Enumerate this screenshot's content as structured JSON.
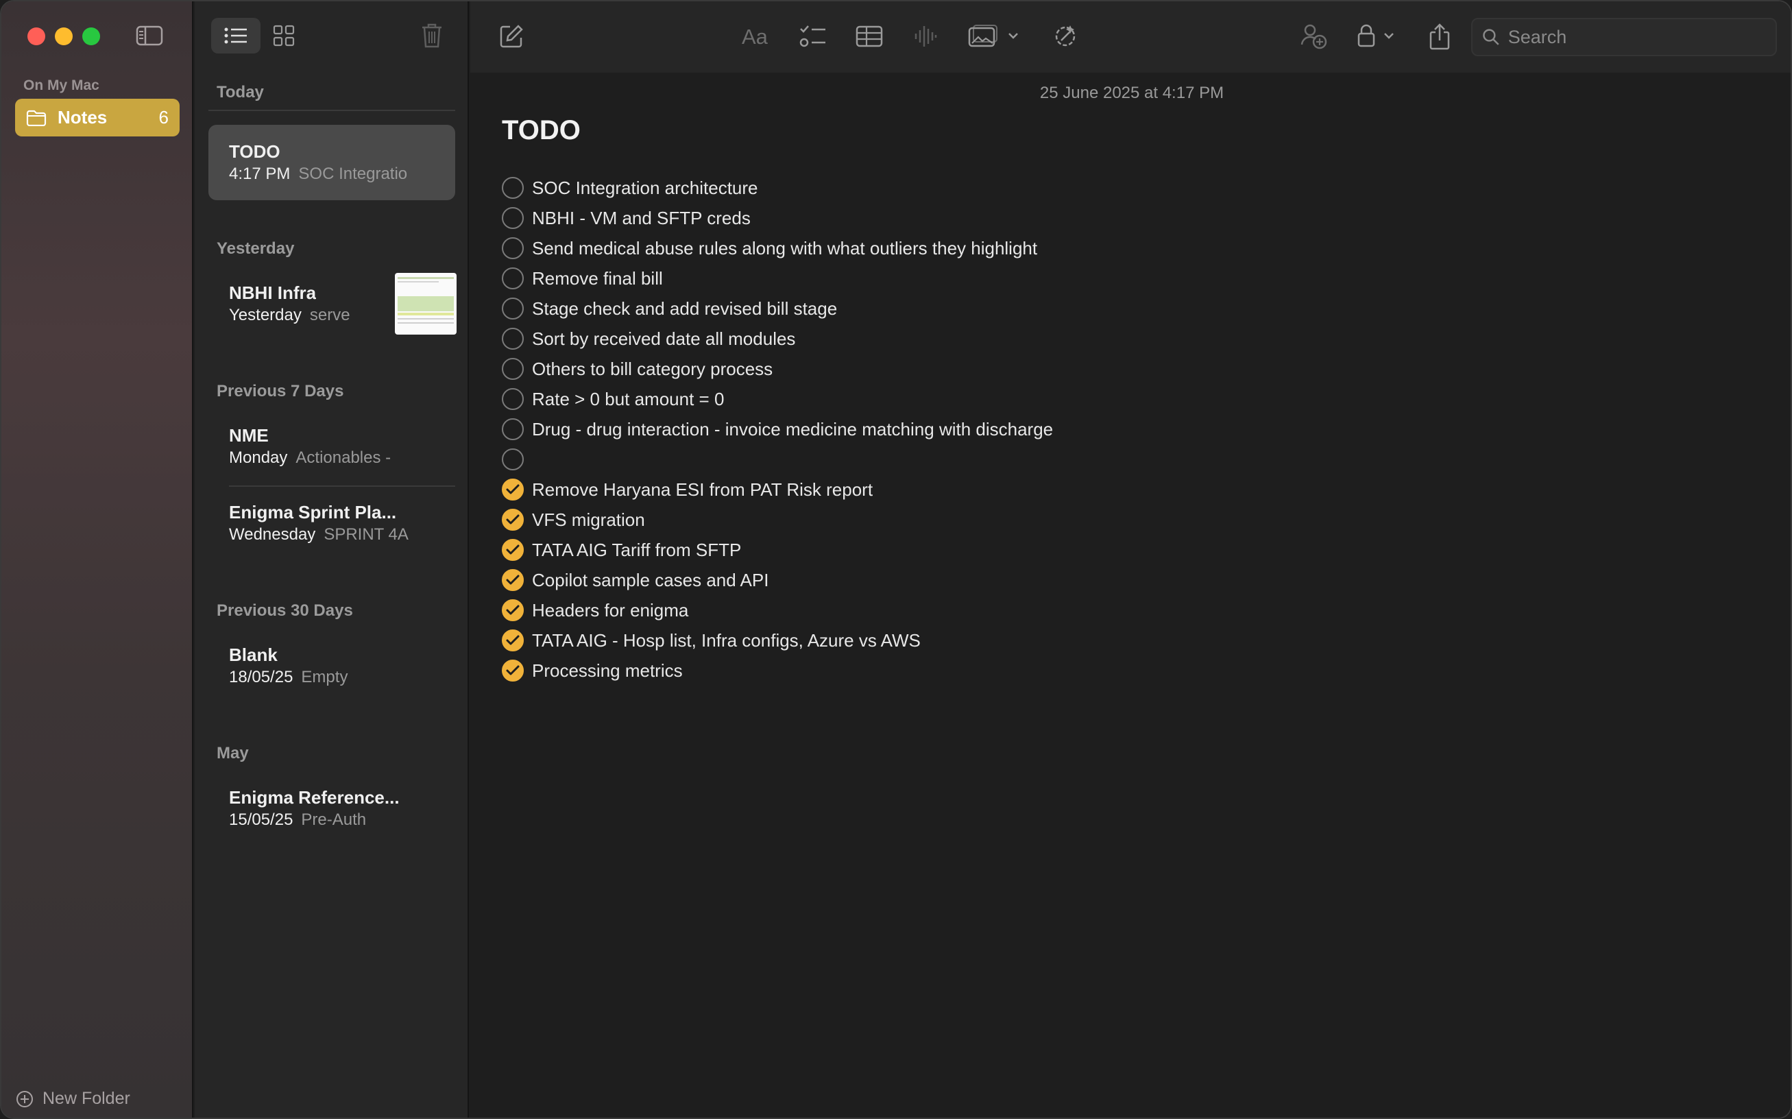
{
  "sidebar": {
    "section_label": "On My Mac",
    "folder": {
      "label": "Notes",
      "count": "6"
    },
    "new_folder_label": "New Folder"
  },
  "notelist": {
    "groups": [
      {
        "heading": "Today"
      },
      {
        "heading": "Yesterday"
      },
      {
        "heading": "Previous 7 Days"
      },
      {
        "heading": "Previous 30 Days"
      },
      {
        "heading": "May"
      }
    ],
    "notes": [
      {
        "title": "TODO",
        "date": "4:17 PM",
        "preview": "SOC Integratio"
      },
      {
        "title": "NBHI Infra",
        "date": "Yesterday",
        "preview": "serve"
      },
      {
        "title": "NME",
        "date": "Monday",
        "preview": "Actionables -"
      },
      {
        "title": "Enigma Sprint Pla...",
        "date": "Wednesday",
        "preview": "SPRINT 4A"
      },
      {
        "title": "Blank",
        "date": "18/05/25",
        "preview": "Empty"
      },
      {
        "title": "Enigma Reference...",
        "date": "15/05/25",
        "preview": "Pre-Auth"
      }
    ]
  },
  "editor": {
    "search_placeholder": "Search",
    "date_line": "25 June 2025 at 4:17 PM",
    "title": "TODO",
    "todos": [
      {
        "text": "SOC Integration architecture",
        "checked": false
      },
      {
        "text": "NBHI - VM and SFTP creds",
        "checked": false
      },
      {
        "text": "Send medical abuse rules along with what outliers they highlight",
        "checked": false
      },
      {
        "text": "Remove final bill",
        "checked": false
      },
      {
        "text": "Stage check and add revised bill stage",
        "checked": false
      },
      {
        "text": "Sort by received date all modules",
        "checked": false
      },
      {
        "text": "Others to bill category process",
        "checked": false
      },
      {
        "text": "Rate > 0 but amount = 0",
        "checked": false
      },
      {
        "text": "Drug - drug interaction - invoice medicine matching with discharge",
        "checked": false
      },
      {
        "text": "",
        "checked": false
      },
      {
        "text": "Remove Haryana ESI from PAT Risk report",
        "checked": true
      },
      {
        "text": "VFS migration",
        "checked": true
      },
      {
        "text": "TATA AIG Tariff from SFTP",
        "checked": true
      },
      {
        "text": "Copilot sample cases and API",
        "checked": true
      },
      {
        "text": "Headers for enigma",
        "checked": true
      },
      {
        "text": "TATA AIG - Hosp list, Infra configs, Azure vs AWS",
        "checked": true
      },
      {
        "text": "Processing metrics",
        "checked": true
      }
    ]
  },
  "colors": {
    "accent": "#c9a640",
    "checkbox_checked": "#f0b23a"
  }
}
